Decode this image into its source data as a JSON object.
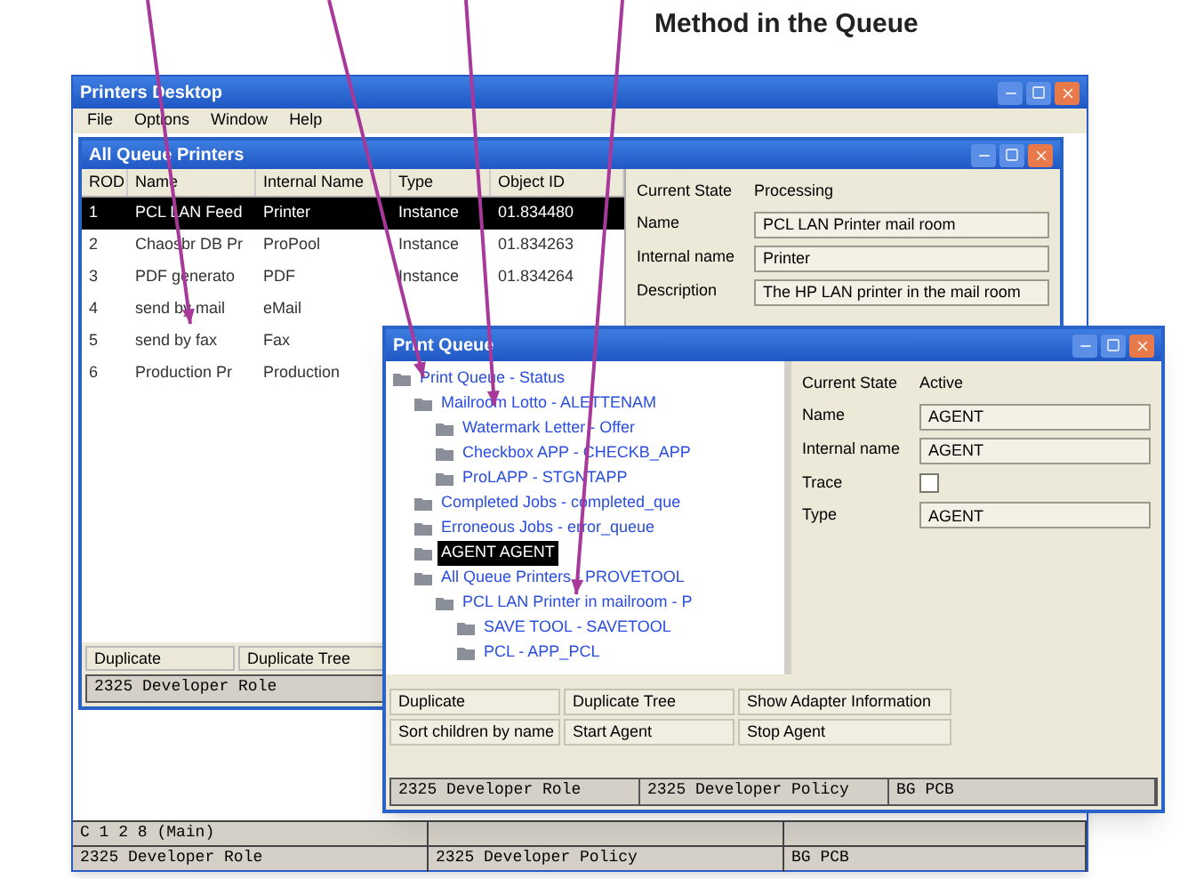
{
  "caption": "Method in the Queue",
  "window": {
    "title": "Printers Desktop",
    "menu": [
      "File",
      "Options",
      "Window",
      "Help"
    ]
  },
  "printers_window": {
    "title": "All Queue Printers",
    "columns": [
      "ROD",
      "Name",
      "Internal Name",
      "Type",
      "Object ID"
    ],
    "rows": [
      {
        "cells": [
          "1",
          "PCL LAN Feed",
          "Printer",
          "Instance",
          "01.834480"
        ],
        "selected": true
      },
      {
        "cells": [
          "2",
          "Chaosbr DB Pr",
          "ProPool",
          "Instance",
          "01.834263"
        ],
        "selected": false
      },
      {
        "cells": [
          "3",
          "PDF generato",
          "PDF",
          "Instance",
          "01.834264"
        ],
        "selected": false
      },
      {
        "cells": [
          "4",
          "send by mail",
          "eMail"
        ],
        "selected": false
      },
      {
        "cells": [
          "5",
          "send by fax",
          "Fax"
        ],
        "selected": false
      },
      {
        "cells": [
          "6",
          "Production Pr",
          "Production"
        ],
        "selected": false
      }
    ],
    "details": [
      {
        "kind": "text",
        "label": "Current State",
        "value": "Processing"
      },
      {
        "kind": "field",
        "label": "Name",
        "value": "PCL LAN Printer mail room"
      },
      {
        "kind": "field",
        "label": "Internal name",
        "value": "Printer"
      },
      {
        "kind": "field",
        "label": "Description",
        "value": "The HP LAN printer in the mail room"
      }
    ],
    "buttons": [
      "Duplicate",
      "Duplicate Tree"
    ],
    "status": "2325 Developer Role"
  },
  "queue_window": {
    "title": "Print Queue",
    "tree": [
      {
        "label": "Print Queue - Status",
        "selected": false,
        "children": [
          {
            "label": "Mailroom Lotto - ALETTENAM",
            "selected": false,
            "children": [
              {
                "label": "Watermark Letter - Offer",
                "selected": false
              },
              {
                "label": "Checkbox APP - CHECKB_APP",
                "selected": false
              },
              {
                "label": "ProLAPP - STGNTAPP",
                "selected": false
              }
            ]
          },
          {
            "label": "Completed Jobs - completed_que",
            "selected": false
          },
          {
            "label": "Erroneous Jobs - error_queue",
            "selected": false
          },
          {
            "label": "AGENT AGENT",
            "selected": true
          },
          {
            "label": "All Queue Printers - PROVETOOL",
            "selected": false,
            "children": [
              {
                "label": "PCL LAN Printer in mailroom - P",
                "selected": false,
                "children": [
                  {
                    "label": "SAVE TOOL - SAVETOOL",
                    "selected": false
                  },
                  {
                    "label": "PCL - APP_PCL",
                    "selected": false
                  }
                ]
              }
            ]
          }
        ]
      }
    ],
    "details": [
      {
        "kind": "text",
        "label": "Current State",
        "value": "Active"
      },
      {
        "kind": "field",
        "label": "Name",
        "value": "AGENT"
      },
      {
        "kind": "field",
        "label": "Internal name",
        "value": "AGENT"
      },
      {
        "kind": "checkbox",
        "label": "Trace",
        "checked": false
      },
      {
        "kind": "field",
        "label": "Type",
        "value": "AGENT"
      }
    ],
    "buttons": [
      "Duplicate",
      "Duplicate Tree",
      "Show Adapter Information",
      "Sort children by name",
      "Start Agent",
      "Stop Agent"
    ],
    "status_bar": [
      "2325 Developer Role",
      "2325 Developer Policy",
      "BG PCB"
    ]
  },
  "status_bar": [
    [
      "C 1 2 8 (Main)"
    ],
    [
      "2325 Developer Role",
      "2325 Developer Policy",
      "BG PCB"
    ]
  ]
}
